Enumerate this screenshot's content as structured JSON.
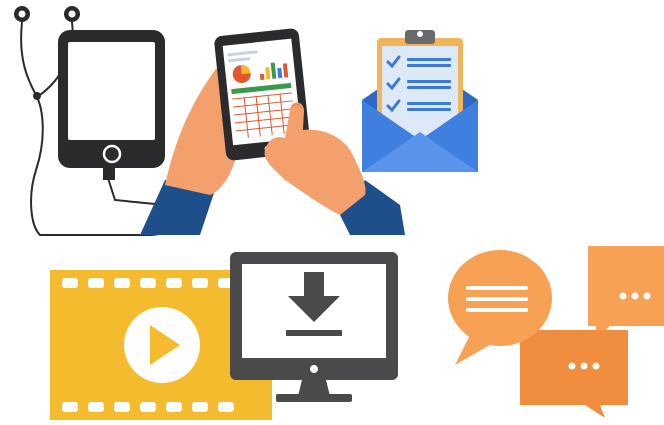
{
  "illustrations": [
    {
      "icon": "tablet-with-earphones-icon"
    },
    {
      "icon": "hands-holding-tablet-with-charts-icon"
    },
    {
      "icon": "checklist-envelope-icon"
    },
    {
      "icon": "video-film-strip-play-icon"
    },
    {
      "icon": "monitor-download-icon"
    },
    {
      "icon": "chat-bubbles-icon"
    }
  ],
  "colors": {
    "dark_device": "#2b2b2d",
    "screen_white": "#ffffff",
    "skin": "#f3a06c",
    "skin_shadow": "#e58a55",
    "sleeve_blue": "#1f4f8b",
    "envelope_blue": "#3f7fe0",
    "envelope_flap": "#2f69c6",
    "clipboard_paper": "#dde9f7",
    "clipboard_border": "#f0b45a",
    "check_blue": "#3a79d8",
    "film_yellow": "#f4bb2f",
    "film_hole": "#ffffff",
    "play_yellow": "#f4bb2f",
    "monitor_gray": "#4a4a4c",
    "chat_orange": "#f7a154",
    "chat_orange_dark": "#f08d3e"
  }
}
